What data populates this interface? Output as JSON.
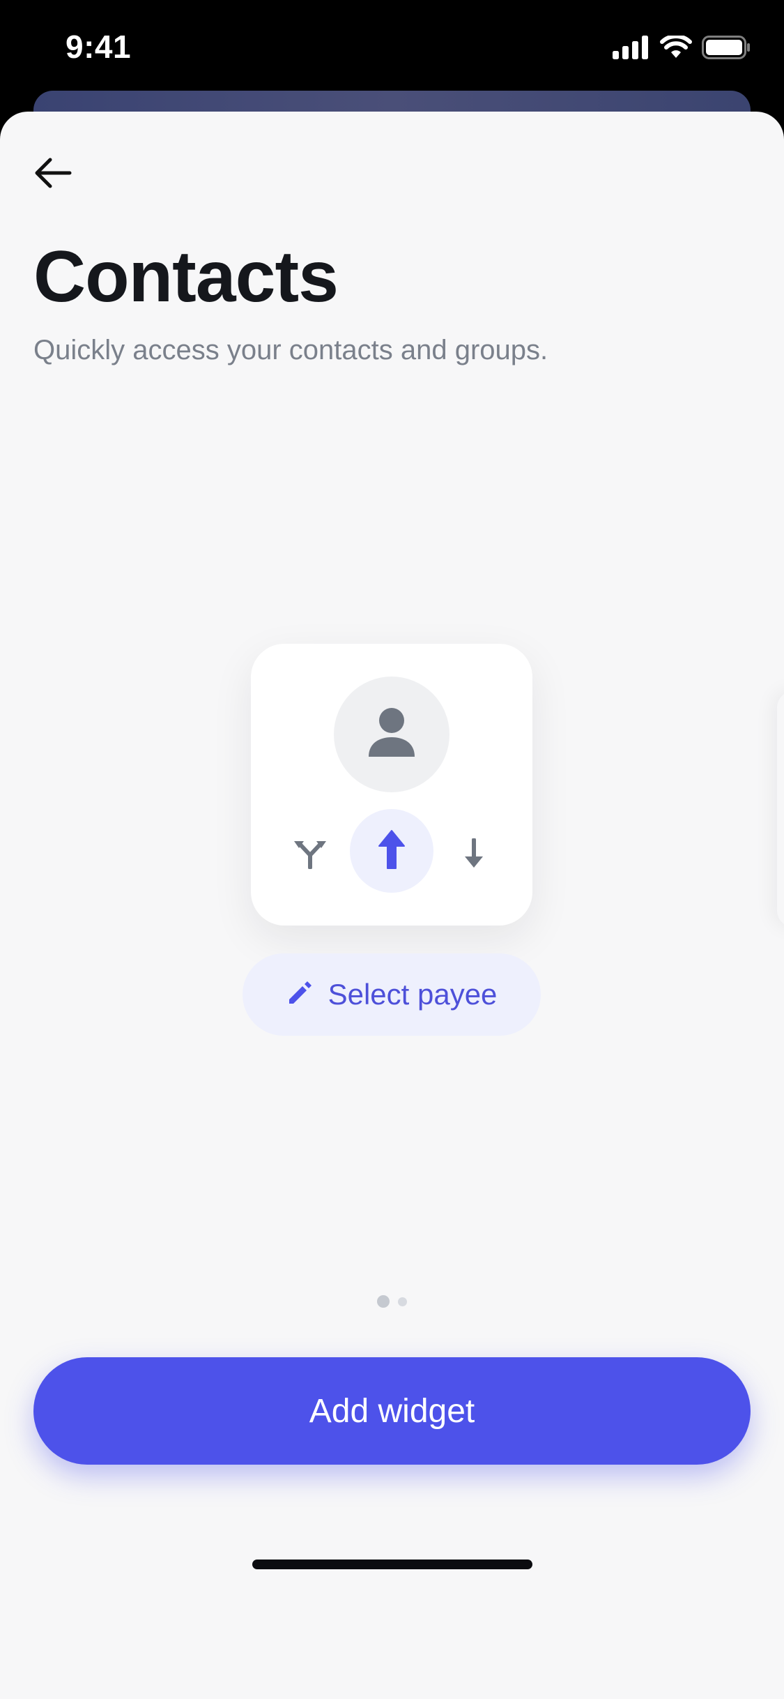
{
  "status_bar": {
    "time": "9:41"
  },
  "header": {
    "back_icon": "arrow-left-icon",
    "title": "Contacts",
    "subtitle": "Quickly access your contacts and groups."
  },
  "widget_preview": {
    "avatar_icon": "person-icon",
    "actions": [
      {
        "icon": "split-icon"
      },
      {
        "icon": "arrow-up-icon"
      },
      {
        "icon": "arrow-down-icon"
      }
    ],
    "select_payee": {
      "icon": "pencil-icon",
      "label": "Select payee"
    }
  },
  "pagination": {
    "current": 1,
    "total": 2
  },
  "footer": {
    "add_widget_label": "Add widget"
  },
  "colors": {
    "accent": "#4d52ea",
    "accent_soft": "#eef0fd",
    "title": "#15171c",
    "subtitle": "#7a808b",
    "sheet": "#f7f7f8"
  }
}
